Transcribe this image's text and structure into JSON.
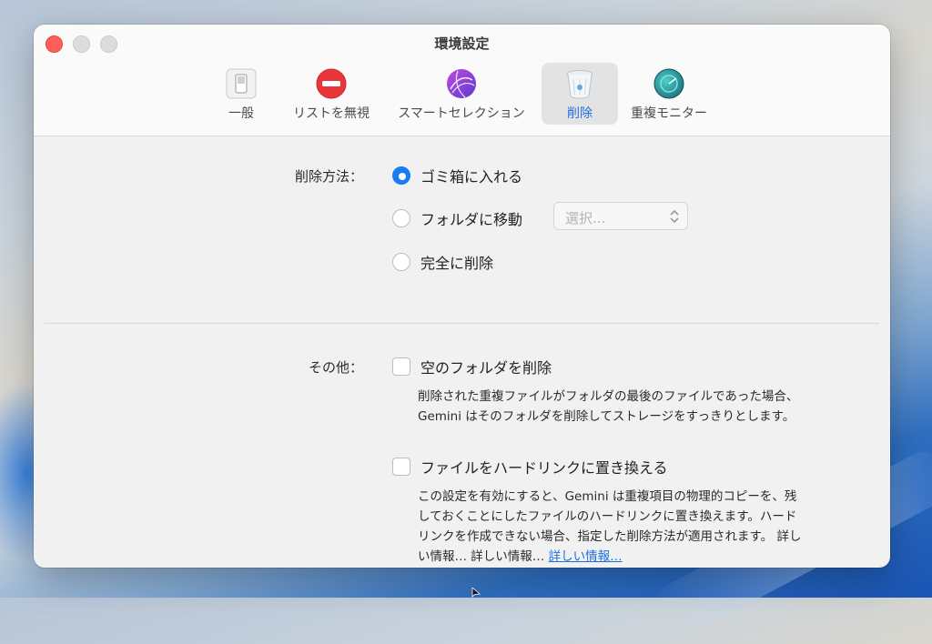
{
  "window": {
    "title": "環境設定"
  },
  "toolbar": {
    "tabs": [
      {
        "label": "一般",
        "icon": "switch-icon",
        "active": false
      },
      {
        "label": "リストを無視",
        "icon": "no-entry-icon",
        "active": false
      },
      {
        "label": "スマートセレクション",
        "icon": "smart-selection-icon",
        "active": false
      },
      {
        "label": "削除",
        "icon": "trash-icon",
        "active": true
      },
      {
        "label": "重複モニター",
        "icon": "monitor-icon",
        "active": false
      }
    ]
  },
  "delete_method": {
    "label": "削除方法：",
    "options": [
      {
        "label": "ゴミ箱に入れる",
        "selected": true
      },
      {
        "label": "フォルダに移動",
        "selected": false
      },
      {
        "label": "完全に削除",
        "selected": false
      }
    ],
    "folder_select_placeholder": "選択..."
  },
  "other": {
    "label": "その他：",
    "empty_folders": {
      "label": "空のフォルダを削除",
      "checked": false,
      "description_line1": "削除された重複ファイルがフォルダの最後のファイルであった場合、",
      "description_line2": "Gemini はそのフォルダを削除してストレージをすっきりとします。"
    },
    "hardlink": {
      "label": "ファイルをハードリンクに置き換える",
      "checked": false,
      "description_line1": "この設定を有効にすると、Gemini は重複項目の物理的コピーを、残",
      "description_line2": "しておくことにしたファイルのハードリンクに置き換えます。ハード",
      "description_line3": "リンクを作成できない場合、指定した削除方法が適用されます。 詳し",
      "description_line4_prefix": "い情報… 詳しい情報…",
      "link_text": "詳しい情報…"
    }
  },
  "colors": {
    "accent": "#1a7cf5",
    "close_button": "#fe5f57"
  }
}
